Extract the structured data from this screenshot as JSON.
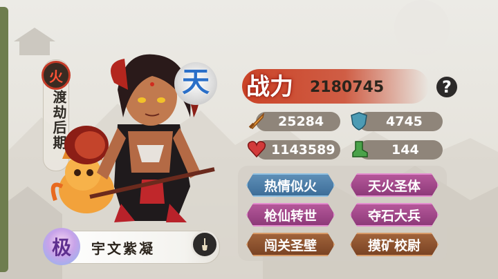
{
  "realm": {
    "element": "火",
    "stage": "渡劫后期"
  },
  "rank_badge": "天",
  "power": {
    "label": "战力",
    "value": "2180745"
  },
  "stats": {
    "attack": "25284",
    "defense": "4745",
    "hp": "1143589",
    "speed": "144"
  },
  "traits": [
    {
      "label": "热情似火",
      "style": "blue"
    },
    {
      "label": "天火圣体",
      "style": "pink"
    },
    {
      "label": "枪仙转世",
      "style": "pink"
    },
    {
      "label": "夺石大兵",
      "style": "pink"
    },
    {
      "label": "闯关圣壁",
      "style": "brown"
    },
    {
      "label": "摸矿校尉",
      "style": "brown"
    }
  ],
  "character": {
    "grade": "极",
    "name": "宇文紫凝"
  },
  "colors": {
    "accent_red": "#c93b1e",
    "panel_gray": "#8f857a"
  },
  "icons": {
    "help": "question-icon",
    "rename": "brush-icon"
  }
}
